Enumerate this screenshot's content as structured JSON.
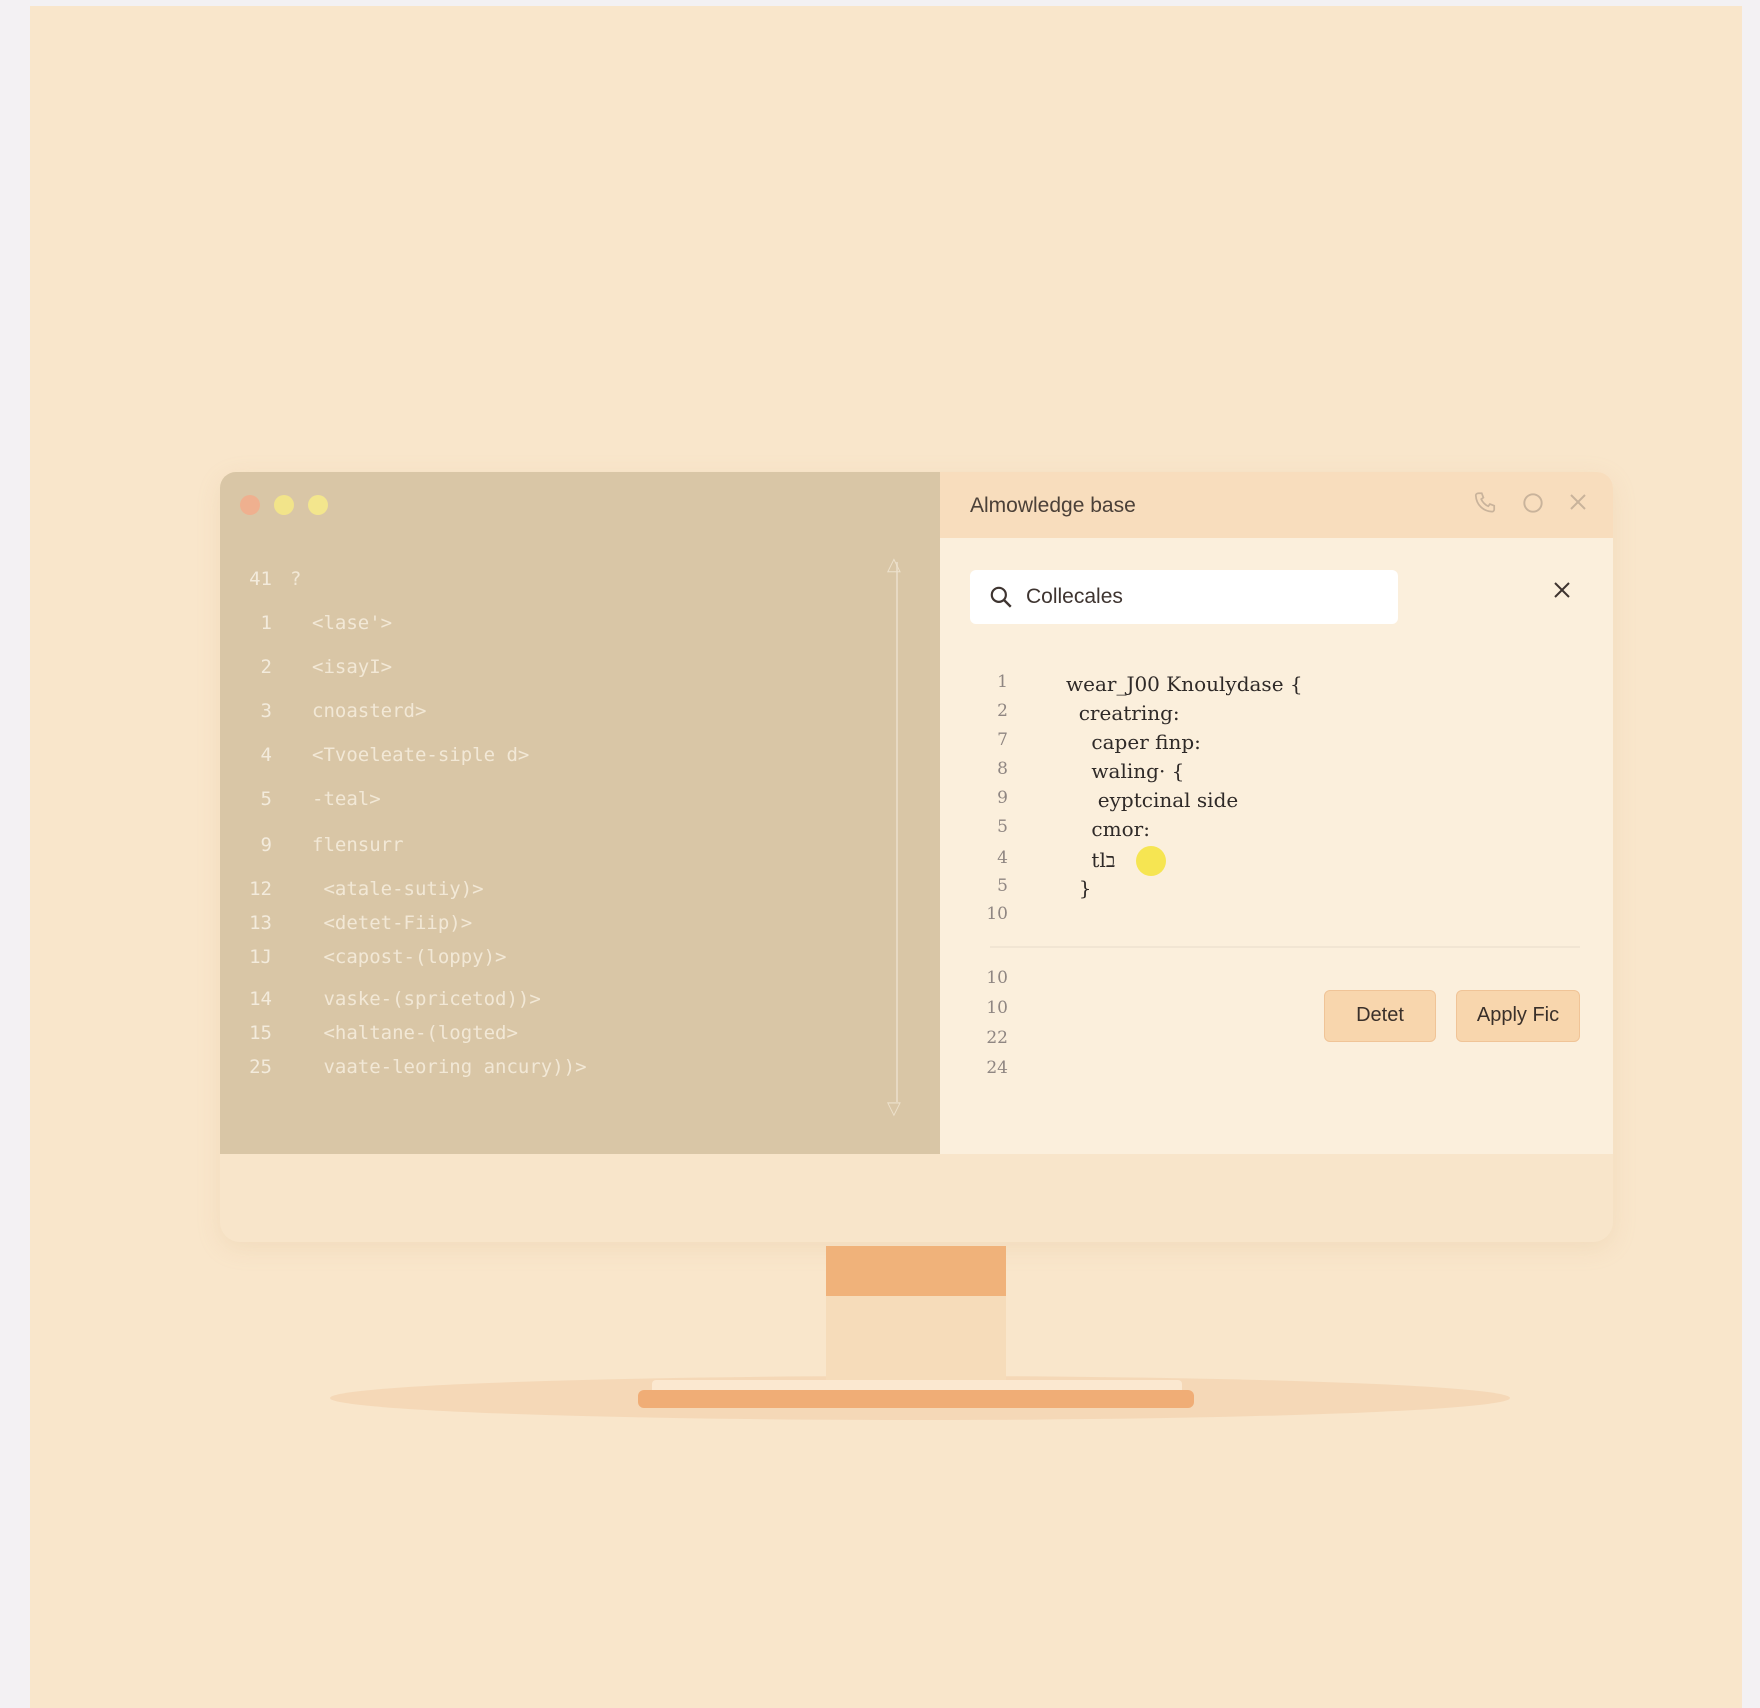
{
  "editor": {
    "lines": [
      {
        "num": "41",
        "text": "?"
      },
      {
        "num": "1",
        "text": "<lase'>"
      },
      {
        "num": "2",
        "text": "<isayI>"
      },
      {
        "num": "3",
        "text": "cnoasterd>"
      },
      {
        "num": "4",
        "text": "<Tvoeleate-siple d>"
      },
      {
        "num": "5",
        "text": "-teal>"
      },
      {
        "num": "9",
        "text": "flensurr"
      },
      {
        "num": "12",
        "text": " <atale-sutiy)>"
      },
      {
        "num": "13",
        "text": " <detet-Fiip)>"
      },
      {
        "num": "1J",
        "text": " <capost-(loppy)>"
      },
      {
        "num": "14",
        "text": " vaske-(spricetod))>"
      },
      {
        "num": "15",
        "text": " <haltane-(logted>"
      },
      {
        "num": "25",
        "text": " vaate-leoring ancury))>"
      }
    ]
  },
  "knowledge_base": {
    "title": "Almowledge base",
    "search": {
      "value": "Collecales"
    },
    "code_lines": [
      {
        "num": "1",
        "text": "wear_J00 Knoulydase {"
      },
      {
        "num": "2",
        "text": "  creatring:"
      },
      {
        "num": "7",
        "text": "    caper finp:"
      },
      {
        "num": "8",
        "text": "    waling· {"
      },
      {
        "num": "9",
        "text": "     eyptcinal side"
      },
      {
        "num": "5",
        "text": "    cmor:"
      },
      {
        "num": "4",
        "text": "    tlב"
      },
      {
        "num": "5",
        "text": "  }"
      },
      {
        "num": "10",
        "text": ""
      },
      {
        "num": "10",
        "text": ""
      },
      {
        "num": "10",
        "text": ""
      },
      {
        "num": "22",
        "text": ""
      },
      {
        "num": "24",
        "text": ""
      }
    ],
    "buttons": {
      "detect": "Detet",
      "apply": "Apply Fic"
    }
  },
  "icons": [
    "phone-icon",
    "refresh-icon",
    "close-icon",
    "search-icon",
    "clear-search-icon",
    "scroll-up-icon",
    "scroll-down-icon"
  ],
  "colors": {
    "background": "#f9e6cb",
    "editor": "#d9c6a6",
    "accent": "#f0ad76",
    "button": "#f8d6ad",
    "highlight": "#f4e33a"
  }
}
